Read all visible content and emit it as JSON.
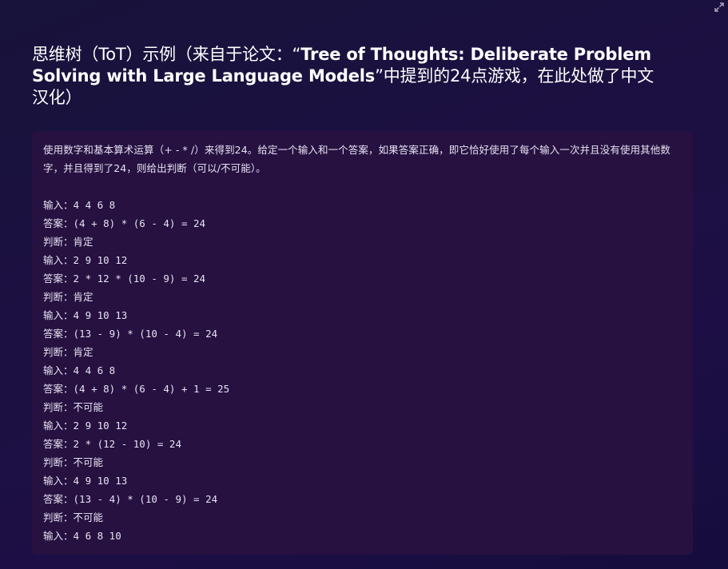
{
  "header": {
    "title_part1": "思维树（ToT）示例（来自于论文：“",
    "title_part2": "Tree of Thoughts: Deliberate Problem Solving with Large Language Models",
    "title_part3": "”中提到的24点游戏，在此处做了中文汉化）"
  },
  "corner_icon": "expand-icon",
  "prompt": {
    "intro": "使用数字和基本算术运算（+ - * /）来得到24。给定一个输入和一个答案，如果答案正确，即它恰好使用了每个输入一次并且没有使用其他数字，并且得到了24，则给出判断（可以/不可能）。",
    "lines": [
      {
        "label": "输入：",
        "value": "4 4 6 8"
      },
      {
        "label": "答案：",
        "value": "(4 + 8) * (6 - 4) = 24"
      },
      {
        "label": "判断：",
        "value": "肯定"
      },
      {
        "label": "输入：",
        "value": "2 9 10 12"
      },
      {
        "label": "答案：",
        "value": "2 * 12 * (10 - 9) = 24"
      },
      {
        "label": "判断：",
        "value": "肯定"
      },
      {
        "label": "输入：",
        "value": "4 9 10 13"
      },
      {
        "label": "答案：",
        "value": "(13 - 9) * (10 - 4) = 24"
      },
      {
        "label": "判断：",
        "value": "肯定"
      },
      {
        "label": "输入：",
        "value": "4 4 6 8"
      },
      {
        "label": "答案：",
        "value": "(4 + 8) * (6 - 4) + 1 = 25"
      },
      {
        "label": "判断：",
        "value": "不可能"
      },
      {
        "label": "输入：",
        "value": "2 9 10 12"
      },
      {
        "label": "答案：",
        "value": "2 * (12 - 10) = 24"
      },
      {
        "label": "判断：",
        "value": "不可能"
      },
      {
        "label": "输入：",
        "value": "4 9 10 13"
      },
      {
        "label": "答案：",
        "value": "(13 - 4) * (10 - 9) = 24"
      },
      {
        "label": "判断：",
        "value": "不可能"
      },
      {
        "label": "输入：",
        "value": "4 6 8 10"
      }
    ]
  }
}
